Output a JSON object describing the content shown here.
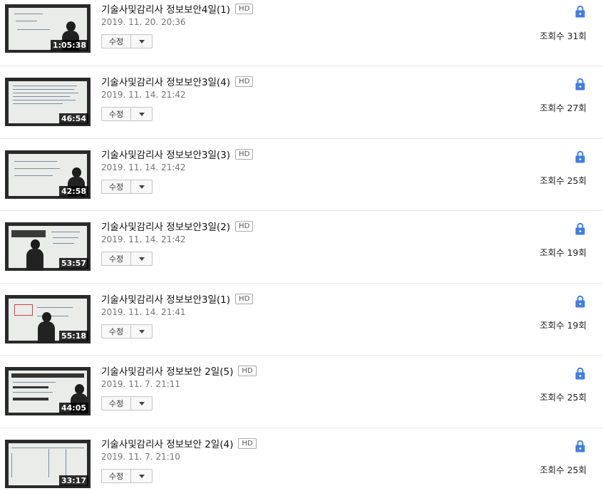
{
  "videos": [
    {
      "title": "기술사및감리사 정보보안4일(1)",
      "badge": "HD",
      "date": "2019. 11. 20. 20:36",
      "duration": "1:05:38",
      "edit_label": "수정",
      "views": "조회수 31회",
      "visibility_icon": "lock-icon"
    },
    {
      "title": "기술사및감리사 정보보안3일(4)",
      "badge": "HD",
      "date": "2019. 11. 14. 21:42",
      "duration": "46:54",
      "edit_label": "수정",
      "views": "조회수 27회",
      "visibility_icon": "lock-icon"
    },
    {
      "title": "기술사및감리사 정보보안3일(3)",
      "badge": "HD",
      "date": "2019. 11. 14. 21:42",
      "duration": "42:58",
      "edit_label": "수정",
      "views": "조회수 25회",
      "visibility_icon": "lock-icon"
    },
    {
      "title": "기술사및감리사 정보보안3일(2)",
      "badge": "HD",
      "date": "2019. 11. 14. 21:42",
      "duration": "53:57",
      "edit_label": "수정",
      "views": "조회수 19회",
      "visibility_icon": "lock-icon"
    },
    {
      "title": "기술사및감리사 정보보안3일(1)",
      "badge": "HD",
      "date": "2019. 11. 14. 21:41",
      "duration": "55:18",
      "edit_label": "수정",
      "views": "조회수 19회",
      "visibility_icon": "lock-icon"
    },
    {
      "title": "기술사및감리사 정보보안 2일(5)",
      "badge": "HD",
      "date": "2019. 11. 7. 21:11",
      "duration": "44:05",
      "edit_label": "수정",
      "views": "조회수 25회",
      "visibility_icon": "lock-icon"
    },
    {
      "title": "기술사및감리사 정보보안 2일(4)",
      "badge": "HD",
      "date": "2019. 11. 7. 21:10",
      "duration": "33:17",
      "edit_label": "수정",
      "views": "조회수 25회",
      "visibility_icon": "lock-icon"
    }
  ],
  "colors": {
    "lock": "#3f7ee8",
    "duration_bg": "#000000",
    "separator": "#e8e8e8"
  }
}
